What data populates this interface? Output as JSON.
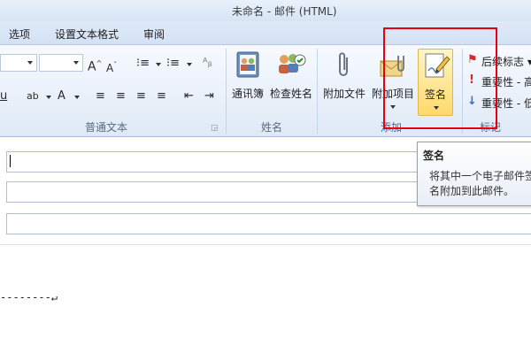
{
  "window": {
    "title": "未命名 - 邮件 (HTML)"
  },
  "tabs": [
    {
      "label": "选项"
    },
    {
      "label": "设置文本格式"
    },
    {
      "label": "审阅"
    }
  ],
  "ribbon": {
    "groups": {
      "basic_text": {
        "label": "普通文本"
      },
      "names": {
        "label": "姓名"
      },
      "include": {
        "label": "添加"
      },
      "tags": {
        "label": "标记"
      }
    },
    "buttons": {
      "address_book": "通讯簿",
      "check_names": "检查姓名",
      "attach_file": "附加文件",
      "attach_item": "附加项目",
      "signature": "签名"
    },
    "tags_rows": [
      {
        "label": "后续标志 ▾",
        "icon": "flag-icon",
        "color": "#d22b2b"
      },
      {
        "label": "重要性 - 高",
        "icon": "exclamation-icon",
        "color": "#d22b2b"
      },
      {
        "label": "重要性 - 低",
        "icon": "down-arrow-icon",
        "color": "#2f6fd6"
      }
    ]
  },
  "tooltip": {
    "title": "签名",
    "body": "将其中一个电子邮件签名附加到此邮件。"
  },
  "compose": {
    "signature_separator": "--------↵"
  },
  "colors": {
    "highlight_border": "#e60012",
    "ribbon_bg": "#eaf1fb"
  }
}
